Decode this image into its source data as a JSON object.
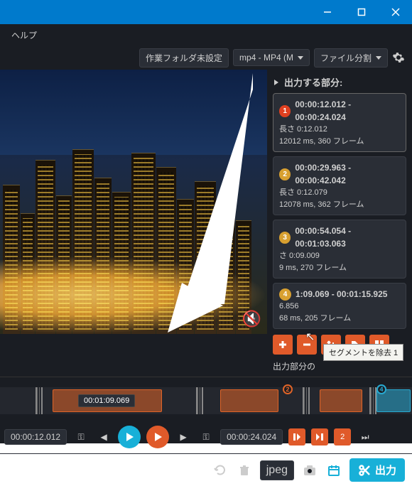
{
  "menu": {
    "help": "ヘルプ"
  },
  "toolbar": {
    "folder": "作業フォルダ未設定",
    "format": "mp4 - MP4 (M",
    "mode": "ファイル分割"
  },
  "side": {
    "title": "出力する部分:",
    "segments": [
      {
        "n": "1",
        "range": "00:00:12.012 - 00:00:24.024",
        "len": "長さ 0:12.012",
        "fr": "12012 ms, 360 フレーム"
      },
      {
        "n": "2",
        "range": "00:00:29.963 - 00:00:42.042",
        "len": "長さ 0:12.079",
        "fr": "12078 ms, 362 フレーム"
      },
      {
        "n": "3",
        "range": "00:00:54.054 - 00:01:03.063",
        "len": "さ 0:09.009",
        "fr": "9 ms, 270 フレーム"
      },
      {
        "n": "4",
        "range": "1:09.069 - 00:01:15.925",
        "len": "6.856",
        "fr": "68   ms, 205 フレーム"
      }
    ],
    "label": "出力部分の",
    "tooltip": "セグメントを除去 1"
  },
  "controls": {
    "in": "00:00:12.012",
    "out": "00:00:24.024",
    "playhead": "00:01:09.069",
    "count": "2",
    "jpeg": "jpeg"
  },
  "export": "出力"
}
